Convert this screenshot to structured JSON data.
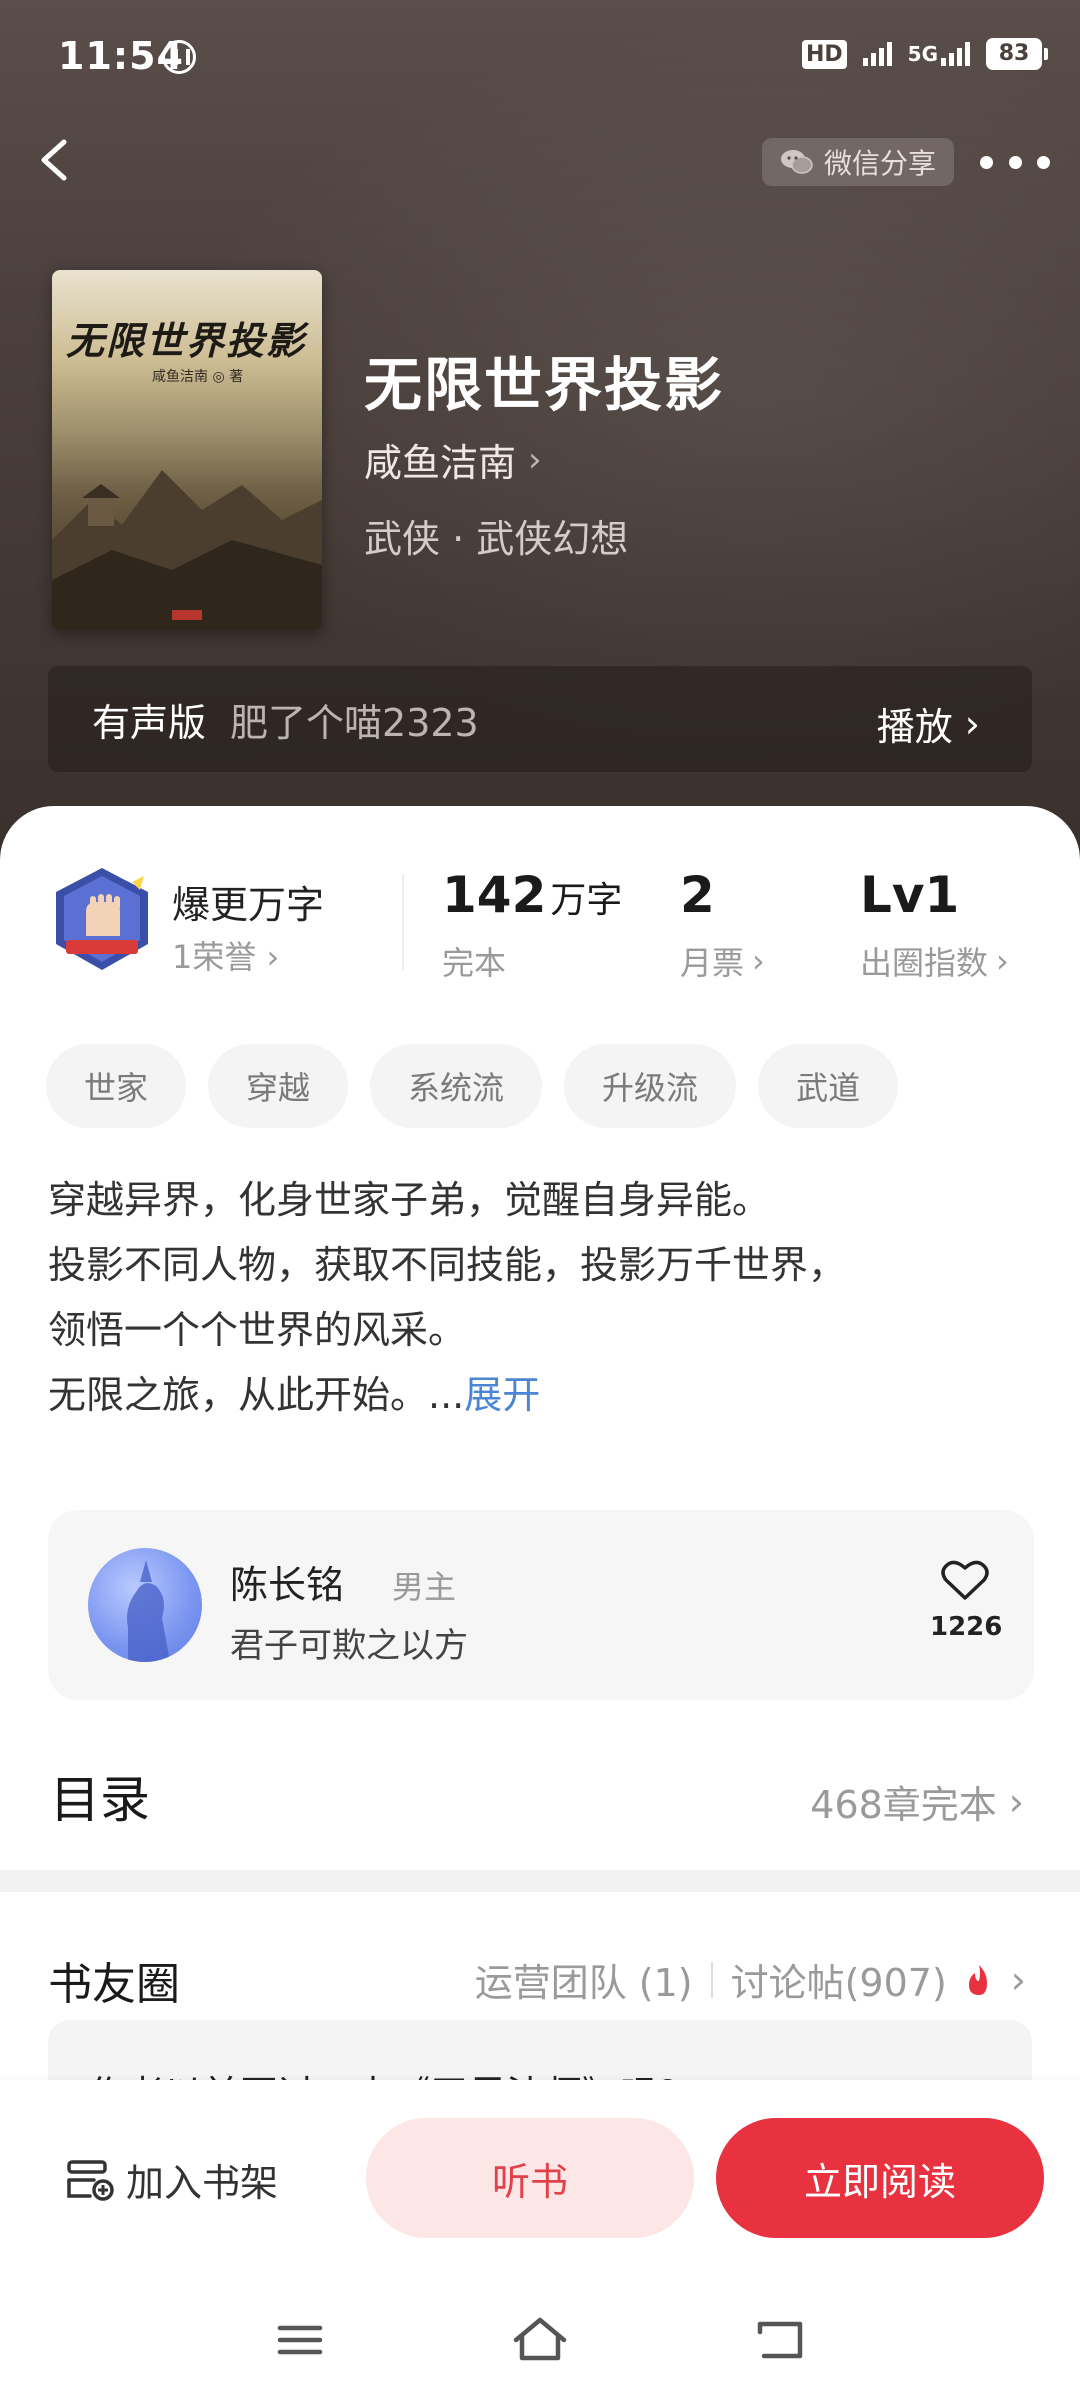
{
  "status_bar": {
    "time": "11:54",
    "hd": "HD",
    "network": "5G",
    "battery": "83"
  },
  "nav": {
    "share_label": "微信分享"
  },
  "book": {
    "cover_title": "无限世界投影",
    "cover_author": "咸鱼洁南 ◎ 著",
    "title": "无限世界投影",
    "author": "咸鱼洁南",
    "genre": "武侠 · 武侠幻想"
  },
  "audio": {
    "label": "有声版",
    "narrator": "肥了个喵2323",
    "play_label": "播放"
  },
  "honor": {
    "title": "爆更万字",
    "sub": "1荣誉"
  },
  "stats": [
    {
      "num": "142",
      "unit": "万字",
      "label": "完本"
    },
    {
      "num": "2",
      "unit": "",
      "label": "月票"
    },
    {
      "num": "Lv1",
      "unit": "",
      "label": "出圈指数"
    }
  ],
  "tags": [
    "世家",
    "穿越",
    "系统流",
    "升级流",
    "武道"
  ],
  "synopsis": {
    "lines": [
      "穿越异界，化身世家子弟，觉醒自身异能。",
      "投影不同人物，获取不同技能，投影万千世界，",
      "领悟一个个世界的风采。",
      "无限之旅，从此开始。..."
    ],
    "expand": "展开"
  },
  "character": {
    "name": "陈长铭",
    "role": "男主",
    "quote": "君子可欺之以方",
    "likes": "1226"
  },
  "toc": {
    "title": "目录",
    "info": "468章完本"
  },
  "circle": {
    "title": "书友圈",
    "team": "运营团队 (1)",
    "posts": "讨论帖(907)",
    "preview": "作者以前写过一本《无尽法师》吗？"
  },
  "actions": {
    "shelf": "加入书架",
    "listen": "听书",
    "read": "立即阅读"
  },
  "colors": {
    "accent": "#e8323f",
    "listen_bg": "#fde6e6",
    "link": "#4a86d4"
  }
}
